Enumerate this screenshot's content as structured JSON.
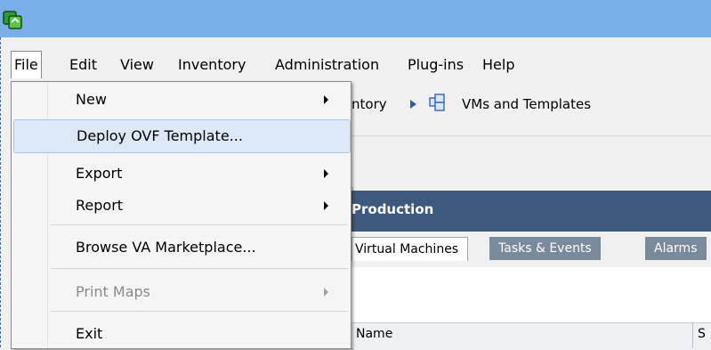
{
  "colors": {
    "titlebar": "#7aaee6",
    "panel_header": "#3d5a7c",
    "highlight": "#dde8f6"
  },
  "menubar": {
    "items": [
      "File",
      "Edit",
      "View",
      "Inventory",
      "Administration",
      "Plug-ins",
      "Help"
    ]
  },
  "breadcrumb": {
    "prev": "ntory",
    "current": "VMs and Templates"
  },
  "panel": {
    "title": "Production"
  },
  "tabs": [
    "Virtual Machines",
    "Tasks & Events",
    "Alarms"
  ],
  "table": {
    "columns": [
      "Name",
      "S"
    ]
  },
  "file_menu": {
    "items": [
      {
        "label": "New",
        "submenu": true,
        "disabled": false
      },
      {
        "label": "Deploy OVF Template...",
        "submenu": false,
        "disabled": false,
        "highlighted": true
      },
      {
        "label": "Export",
        "submenu": true,
        "disabled": false
      },
      {
        "label": "Report",
        "submenu": true,
        "disabled": false
      },
      {
        "label": "Browse VA Marketplace...",
        "submenu": false,
        "disabled": false
      },
      {
        "label": "Print Maps",
        "submenu": true,
        "disabled": true
      },
      {
        "label": "Exit",
        "submenu": false,
        "disabled": false
      }
    ]
  }
}
